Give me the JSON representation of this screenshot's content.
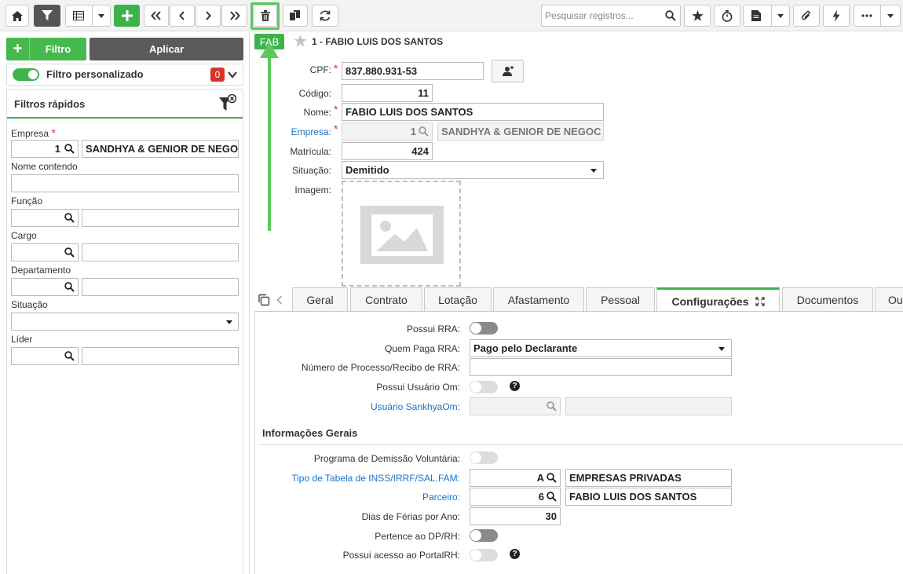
{
  "toolbar": {
    "search_placeholder": "Pesquisar registros..."
  },
  "left_panel": {
    "filter_button": "Filtro",
    "apply_button": "Aplicar",
    "custom_filter_label": "Filtro personalizado",
    "custom_filter_count": "0",
    "quick_filters_title": "Filtros rápidos",
    "fields": {
      "empresa_label": "Empresa",
      "empresa_code": "1",
      "empresa_name": "SANDHYA & GENIOR DE NEGOC",
      "nome_label": "Nome contendo",
      "funcao_label": "Função",
      "cargo_label": "Cargo",
      "departamento_label": "Departamento",
      "situacao_label": "Situação",
      "lider_label": "Líder"
    }
  },
  "record": {
    "badge": "FAB",
    "title": "1 - FABIO LUIS DOS SANTOS",
    "cpf_label": "CPF:",
    "cpf_value": "837.880.931-53",
    "codigo_label": "Código:",
    "codigo_value": "11",
    "nome_label": "Nome:",
    "nome_value": "FABIO LUIS DOS SANTOS",
    "empresa_label": "Empresa:",
    "empresa_code": "1",
    "empresa_name": "SANDHYA & GENIOR DE NEGOC",
    "matricula_label": "Matrícula:",
    "matricula_value": "424",
    "situacao_label": "Situação:",
    "situacao_value": "Demitido",
    "imagem_label": "Imagem:"
  },
  "tabs": [
    {
      "label": "Geral"
    },
    {
      "label": "Contrato"
    },
    {
      "label": "Lotação"
    },
    {
      "label": "Afastamento"
    },
    {
      "label": "Pessoal"
    },
    {
      "label": "Configurações"
    },
    {
      "label": "Documentos"
    },
    {
      "label": "Ou"
    }
  ],
  "config": {
    "possui_rra_label": "Possui RRA:",
    "quem_paga_label": "Quem Paga RRA:",
    "quem_paga_value": "Pago pelo Declarante",
    "numero_processo_label": "Número de Processo/Recibo de RRA:",
    "possui_usuario_om_label": "Possui Usuário Om:",
    "usuario_sankhya_label": "Usuário SankhyaOm:",
    "section_title": "Informações Gerais",
    "programa_demissao_label": "Programa de Demissão Voluntária:",
    "tipo_tabela_label": "Tipo de Tabela de INSS/IRRF/SAL.FAM:",
    "tipo_tabela_code": "A",
    "tipo_tabela_name": "EMPRESAS PRIVADAS",
    "parceiro_label": "Parceiro:",
    "parceiro_code": "6",
    "parceiro_name": "FABIO LUIS DOS SANTOS",
    "dias_ferias_label": "Dias de Férias por Ano:",
    "dias_ferias_value": "30",
    "pertence_dp_label": "Pertence ao DP/RH:",
    "portal_rh_label": "Possui acesso ao PortalRH:"
  },
  "help_glyph": "?",
  "colors": {
    "accent_green": "#3cb44b",
    "link_blue": "#1a73c8",
    "badge_red": "#d9342b"
  }
}
